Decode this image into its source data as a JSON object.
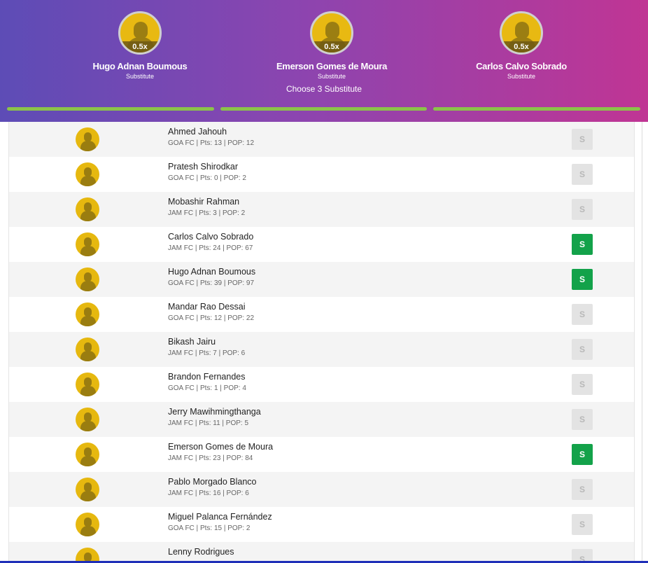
{
  "substitutes": [
    {
      "name": "Hugo Adnan Boumous",
      "role": "Substitute",
      "multiplier": "0.5x"
    },
    {
      "name": "Emerson Gomes de Moura",
      "role": "Substitute",
      "multiplier": "0.5x"
    },
    {
      "name": "Carlos Calvo Sobrado",
      "role": "Substitute",
      "multiplier": "0.5x"
    }
  ],
  "choose_label": "Choose 3 Substitute",
  "progress_fraction": [
    1,
    1,
    1
  ],
  "players": [
    {
      "name": "Ahmed Jahouh",
      "info": "GOA FC | Pts: 13 | POP: 12",
      "button": "S",
      "selected": false
    },
    {
      "name": "Pratesh Shirodkar",
      "info": "GOA FC | Pts: 0 | POP: 2",
      "button": "S",
      "selected": false
    },
    {
      "name": "Mobashir Rahman",
      "info": "JAM FC | Pts: 3 | POP: 2",
      "button": "S",
      "selected": false
    },
    {
      "name": "Carlos Calvo Sobrado",
      "info": "JAM FC | Pts: 24 | POP: 67",
      "button": "S",
      "selected": true
    },
    {
      "name": "Hugo Adnan Boumous",
      "info": "GOA FC | Pts: 39 | POP: 97",
      "button": "S",
      "selected": true
    },
    {
      "name": "Mandar Rao Dessai",
      "info": "GOA FC | Pts: 12 | POP: 22",
      "button": "S",
      "selected": false
    },
    {
      "name": "Bikash Jairu",
      "info": "JAM FC | Pts: 7 | POP: 6",
      "button": "S",
      "selected": false
    },
    {
      "name": "Brandon Fernandes",
      "info": "GOA FC | Pts: 1 | POP: 4",
      "button": "S",
      "selected": false
    },
    {
      "name": "Jerry Mawihmingthanga",
      "info": "JAM FC | Pts: 11 | POP: 5",
      "button": "S",
      "selected": false
    },
    {
      "name": "Emerson Gomes de Moura",
      "info": "JAM FC | Pts: 23 | POP: 84",
      "button": "S",
      "selected": true
    },
    {
      "name": "Pablo Morgado Blanco",
      "info": "JAM FC | Pts: 16 | POP: 6",
      "button": "S",
      "selected": false
    },
    {
      "name": "Miguel Palanca Fernández",
      "info": "GOA FC | Pts: 15 | POP: 2",
      "button": "S",
      "selected": false
    },
    {
      "name": "Lenny Rodrigues",
      "info": "",
      "button": "S",
      "selected": false
    }
  ],
  "colors": {
    "selected": "#13a24a",
    "unselected": "#e3e3e3",
    "progress": "#8bc34a",
    "avatar": "#e6b80f"
  },
  "icons": {
    "player": "player-silhouette-icon"
  }
}
